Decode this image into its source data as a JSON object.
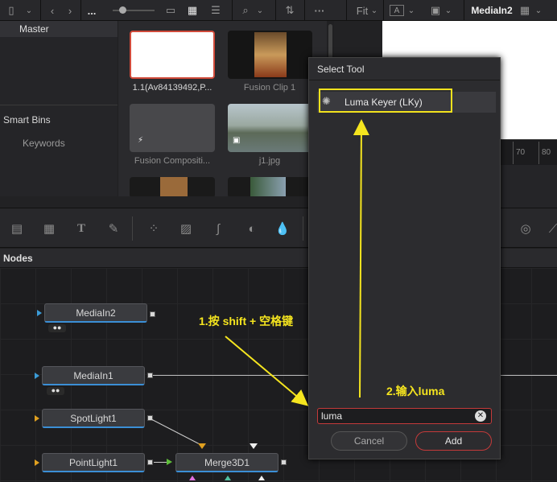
{
  "toolbar": {
    "ellipsis_label": "...",
    "fit_label": "Fit",
    "viewer_title": "MediaIn2"
  },
  "bins": {
    "master": "Master",
    "smart_bins": "Smart Bins",
    "keywords": "Keywords"
  },
  "media": {
    "items": [
      {
        "caption": "1.1(Av84139492,P..."
      },
      {
        "caption": "Fusion Clip 1"
      },
      {
        "caption": "Fusion Compositi..."
      },
      {
        "caption": "j1.jpg"
      }
    ]
  },
  "ruler": {
    "ticks": [
      "70",
      "80"
    ]
  },
  "nodes_header": "Nodes",
  "nodes": [
    {
      "label": "MediaIn2"
    },
    {
      "label": "MediaIn1"
    },
    {
      "label": "SpotLight1"
    },
    {
      "label": "PointLight1"
    },
    {
      "label": "Merge3D1"
    }
  ],
  "dialog": {
    "title": "Select Tool",
    "result": "Luma Keyer (LKy)",
    "search_value": "luma",
    "cancel": "Cancel",
    "add": "Add"
  },
  "annotations": {
    "step1": "1.按 shift + 空格键",
    "step2": "2.输入luma"
  },
  "colors": {
    "highlight": "#f2e21d",
    "accent": "#3b8fd6",
    "danger": "#c43a3a"
  }
}
